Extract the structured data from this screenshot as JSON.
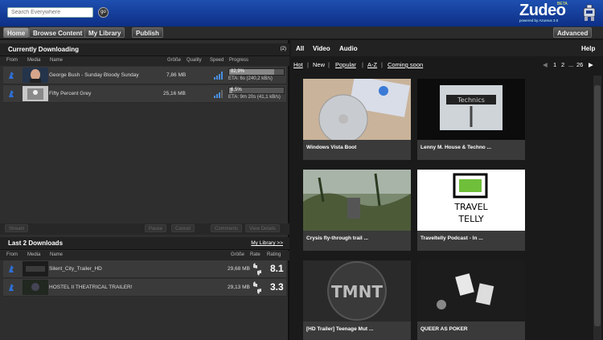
{
  "header": {
    "search_placeholder": "Search Everywhere",
    "go_label": "go",
    "logo": "Zudeo",
    "logo_tagline": "powered by Azureus 3.0",
    "logo_beta": "BETA"
  },
  "nav": {
    "home": "Home",
    "browse": "Browse Content",
    "library": "My Library",
    "publish": "Publish",
    "advanced": "Advanced"
  },
  "current": {
    "title": "Currently Downloading",
    "count": "(2)",
    "columns": {
      "from": "From",
      "media": "Media",
      "name": "Name",
      "size": "Größe",
      "quality": "Quality",
      "speed": "Speed",
      "progress": "Progress"
    },
    "items": [
      {
        "name": "George Bush - Sunday Bloody Sunday",
        "size": "7,86 MB",
        "progress_pct": "82,9%",
        "progress_value": 82.9,
        "eta": "ETA: 6s (240,2 kB/s)"
      },
      {
        "name": "Fifty Percent Grey",
        "size": "25,16 MB",
        "progress_pct": "6,5%",
        "progress_value": 6.5,
        "eta": "ETA: 9m 20s (41,1 kB/s)"
      }
    ],
    "controls": {
      "stream": "Stream",
      "pause": "Pause",
      "cancel": "Cancel",
      "comments": "Comments",
      "details": "View Details"
    }
  },
  "last": {
    "title": "Last 2 Downloads",
    "link": "My Library >>",
    "columns": {
      "from": "From",
      "media": "Media",
      "name": "Name",
      "size": "Größe",
      "rate": "Rate",
      "rating": "Rating"
    },
    "items": [
      {
        "name": "Silent_City_Trailer_HD",
        "size": "29,68 MB",
        "rating": "8.1"
      },
      {
        "name": "HOSTEL II THEATRICAL TRAILER!",
        "size": "29,13 MB",
        "rating": "3.3"
      }
    ]
  },
  "browse": {
    "tabs": {
      "all": "All",
      "video": "Video",
      "audio": "Audio",
      "help": "Help"
    },
    "filters": {
      "hot": "Hot",
      "new": "New",
      "popular": "Popular",
      "az": "A-Z",
      "coming": "Coming soon"
    },
    "pager": {
      "p1": "1",
      "p2": "2",
      "dots": "...",
      "last": "26"
    },
    "cards": [
      {
        "title": "Windows Vista Boot"
      },
      {
        "title": "Lenny M. House & Techno ..."
      },
      {
        "title": "Crysis fly-through trail ..."
      },
      {
        "title": "Traveltelly Podcast - In ..."
      },
      {
        "title": "[HD Trailer] Teenage Mut ..."
      },
      {
        "title": "QUEER AS POKER"
      }
    ],
    "thumb_text": {
      "technics": "Technics",
      "travel1": "TRAVEL",
      "travel2": "TELLY",
      "tmnt": "TMNT"
    }
  }
}
